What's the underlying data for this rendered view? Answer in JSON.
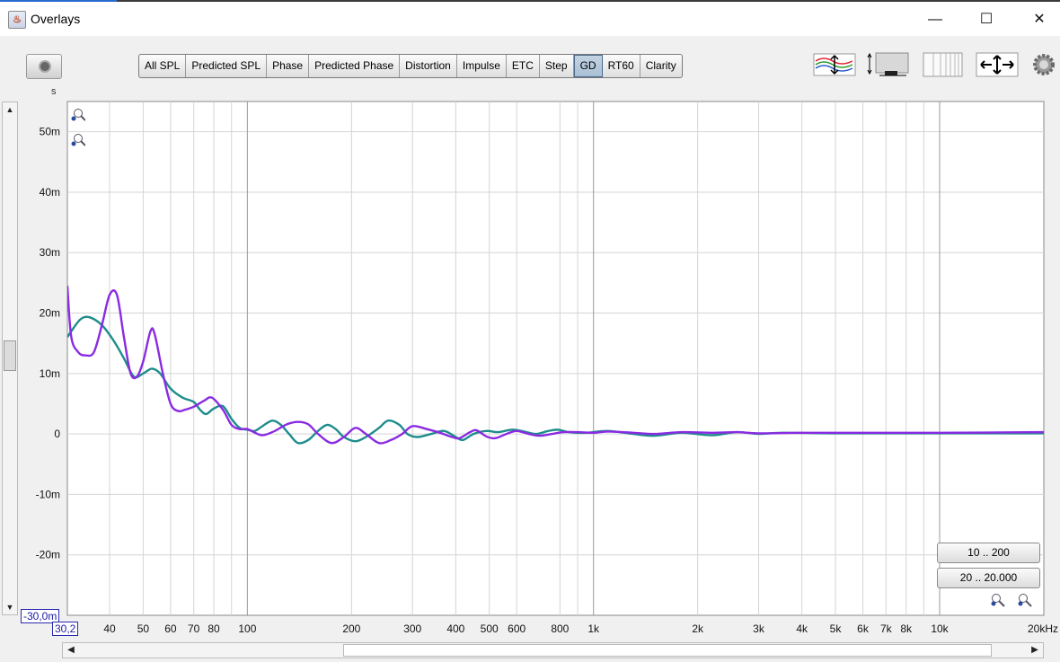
{
  "window": {
    "title": "Overlays",
    "minimize": "—",
    "maximize": "☐",
    "close": "✕"
  },
  "toolbar": {
    "tabs": [
      {
        "label": "All SPL",
        "active": false
      },
      {
        "label": "Predicted SPL",
        "active": false
      },
      {
        "label": "Phase",
        "active": false
      },
      {
        "label": "Predicted Phase",
        "active": false
      },
      {
        "label": "Distortion",
        "active": false
      },
      {
        "label": "Impulse",
        "active": false
      },
      {
        "label": "ETC",
        "active": false
      },
      {
        "label": "Step",
        "active": false
      },
      {
        "label": "GD",
        "active": true
      },
      {
        "label": "RT60",
        "active": false
      },
      {
        "label": "Clarity",
        "active": false
      }
    ],
    "icons": [
      "camera-icon",
      "trace-arrange-icon",
      "legend-position-icon",
      "columns-icon",
      "pan-arrows-icon",
      "gear-icon"
    ]
  },
  "range_buttons": {
    "low": "10 .. 200",
    "full": "20 .. 20.000"
  },
  "readouts": {
    "y": "-30,0m",
    "x": "30,2"
  },
  "chart_data": {
    "type": "line",
    "x_scale": "log",
    "xlim": [
      30.2,
      20000
    ],
    "ylim": [
      -30,
      55
    ],
    "y_unit": "s",
    "y_ticks": [
      {
        "value": 50,
        "label": "50m"
      },
      {
        "value": 40,
        "label": "40m"
      },
      {
        "value": 30,
        "label": "30m"
      },
      {
        "value": 20,
        "label": "20m"
      },
      {
        "value": 10,
        "label": "10m"
      },
      {
        "value": 0,
        "label": "0"
      },
      {
        "value": -10,
        "label": "-10m"
      },
      {
        "value": -20,
        "label": "-20m"
      }
    ],
    "x_ticks": [
      {
        "value": 40,
        "label": "40"
      },
      {
        "value": 50,
        "label": "50"
      },
      {
        "value": 60,
        "label": "60"
      },
      {
        "value": 70,
        "label": "70"
      },
      {
        "value": 80,
        "label": "80"
      },
      {
        "value": 100,
        "label": "100"
      },
      {
        "value": 200,
        "label": "200"
      },
      {
        "value": 300,
        "label": "300"
      },
      {
        "value": 400,
        "label": "400"
      },
      {
        "value": 500,
        "label": "500"
      },
      {
        "value": 600,
        "label": "600"
      },
      {
        "value": 800,
        "label": "800"
      },
      {
        "value": 1000,
        "label": "1k"
      },
      {
        "value": 2000,
        "label": "2k"
      },
      {
        "value": 3000,
        "label": "3k"
      },
      {
        "value": 4000,
        "label": "4k"
      },
      {
        "value": 5000,
        "label": "5k"
      },
      {
        "value": 6000,
        "label": "6k"
      },
      {
        "value": 7000,
        "label": "7k"
      },
      {
        "value": 8000,
        "label": "8k"
      },
      {
        "value": 10000,
        "label": "10k"
      },
      {
        "value": 20000,
        "label": "20kHz"
      }
    ],
    "grid_minor_x": [
      90,
      900,
      9000
    ],
    "grid_major_x": [
      100,
      1000,
      10000
    ],
    "series": [
      {
        "color": "#1e8c8c",
        "points": [
          [
            30.2,
            16
          ],
          [
            31,
            17
          ],
          [
            33,
            19
          ],
          [
            35,
            19.3
          ],
          [
            38,
            18
          ],
          [
            41,
            15.5
          ],
          [
            44,
            12.5
          ],
          [
            47,
            9.5
          ],
          [
            50,
            10
          ],
          [
            53,
            10.8
          ],
          [
            56,
            10
          ],
          [
            60,
            7.5
          ],
          [
            65,
            6
          ],
          [
            70,
            5.3
          ],
          [
            73,
            4
          ],
          [
            76,
            3.3
          ],
          [
            80,
            4.2
          ],
          [
            85,
            4.6
          ],
          [
            90,
            2.5
          ],
          [
            95,
            1
          ],
          [
            100,
            0.7
          ],
          [
            105,
            0.5
          ],
          [
            110,
            1.2
          ],
          [
            118,
            2.2
          ],
          [
            125,
            1.5
          ],
          [
            132,
            0
          ],
          [
            140,
            -1.5
          ],
          [
            150,
            -1
          ],
          [
            160,
            0.5
          ],
          [
            170,
            1.5
          ],
          [
            180,
            0.8
          ],
          [
            190,
            -0.5
          ],
          [
            205,
            -1.2
          ],
          [
            220,
            -0.5
          ],
          [
            240,
            1
          ],
          [
            255,
            2.2
          ],
          [
            275,
            1.5
          ],
          [
            290,
            0
          ],
          [
            310,
            -0.5
          ],
          [
            340,
            0
          ],
          [
            370,
            0.5
          ],
          [
            400,
            -0.5
          ],
          [
            420,
            -1
          ],
          [
            450,
            0
          ],
          [
            490,
            0.5
          ],
          [
            530,
            0.3
          ],
          [
            580,
            0.7
          ],
          [
            620,
            0.5
          ],
          [
            680,
            0
          ],
          [
            740,
            0.5
          ],
          [
            790,
            0.7
          ],
          [
            850,
            0.3
          ],
          [
            950,
            0.2
          ],
          [
            1100,
            0.5
          ],
          [
            1300,
            0
          ],
          [
            1500,
            -0.3
          ],
          [
            1800,
            0.2
          ],
          [
            2200,
            -0.2
          ],
          [
            2600,
            0.3
          ],
          [
            3000,
            0
          ],
          [
            3500,
            0.2
          ],
          [
            5000,
            0.1
          ],
          [
            8000,
            0.1
          ],
          [
            20000,
            0.1
          ]
        ]
      },
      {
        "color": "#8a2be2",
        "points": [
          [
            30.2,
            24.5
          ],
          [
            31,
            16
          ],
          [
            32.5,
            13.5
          ],
          [
            34,
            13
          ],
          [
            36,
            13.5
          ],
          [
            38,
            18
          ],
          [
            40,
            23
          ],
          [
            42,
            23
          ],
          [
            44,
            16
          ],
          [
            46,
            10
          ],
          [
            48,
            9.5
          ],
          [
            50,
            12
          ],
          [
            52.5,
            17
          ],
          [
            54,
            16.5
          ],
          [
            57,
            10
          ],
          [
            60,
            5
          ],
          [
            63,
            3.8
          ],
          [
            66,
            4
          ],
          [
            70,
            4.5
          ],
          [
            75,
            5.5
          ],
          [
            79,
            6
          ],
          [
            85,
            4
          ],
          [
            90,
            1.5
          ],
          [
            95,
            0.8
          ],
          [
            100,
            0.8
          ],
          [
            110,
            -0.2
          ],
          [
            120,
            0.5
          ],
          [
            130,
            1.6
          ],
          [
            140,
            2
          ],
          [
            150,
            1.6
          ],
          [
            160,
            0
          ],
          [
            175,
            -1.5
          ],
          [
            190,
            -0.5
          ],
          [
            205,
            1
          ],
          [
            220,
            0
          ],
          [
            240,
            -1.5
          ],
          [
            260,
            -1
          ],
          [
            280,
            0
          ],
          [
            300,
            1.3
          ],
          [
            330,
            0.8
          ],
          [
            360,
            0.2
          ],
          [
            390,
            -0.5
          ],
          [
            410,
            -0.7
          ],
          [
            440,
            0.3
          ],
          [
            460,
            0.6
          ],
          [
            490,
            -0.4
          ],
          [
            520,
            -0.7
          ],
          [
            560,
            0
          ],
          [
            600,
            0.5
          ],
          [
            650,
            0
          ],
          [
            700,
            -0.3
          ],
          [
            760,
            0
          ],
          [
            820,
            0.3
          ],
          [
            900,
            0.3
          ],
          [
            1000,
            0.2
          ],
          [
            1100,
            0.4
          ],
          [
            1300,
            0.2
          ],
          [
            1500,
            0
          ],
          [
            1800,
            0.3
          ],
          [
            2200,
            0.2
          ],
          [
            2600,
            0.3
          ],
          [
            3000,
            0.1
          ],
          [
            4000,
            0.2
          ],
          [
            6000,
            0.2
          ],
          [
            10000,
            0.2
          ],
          [
            20000,
            0.3
          ]
        ]
      }
    ]
  }
}
